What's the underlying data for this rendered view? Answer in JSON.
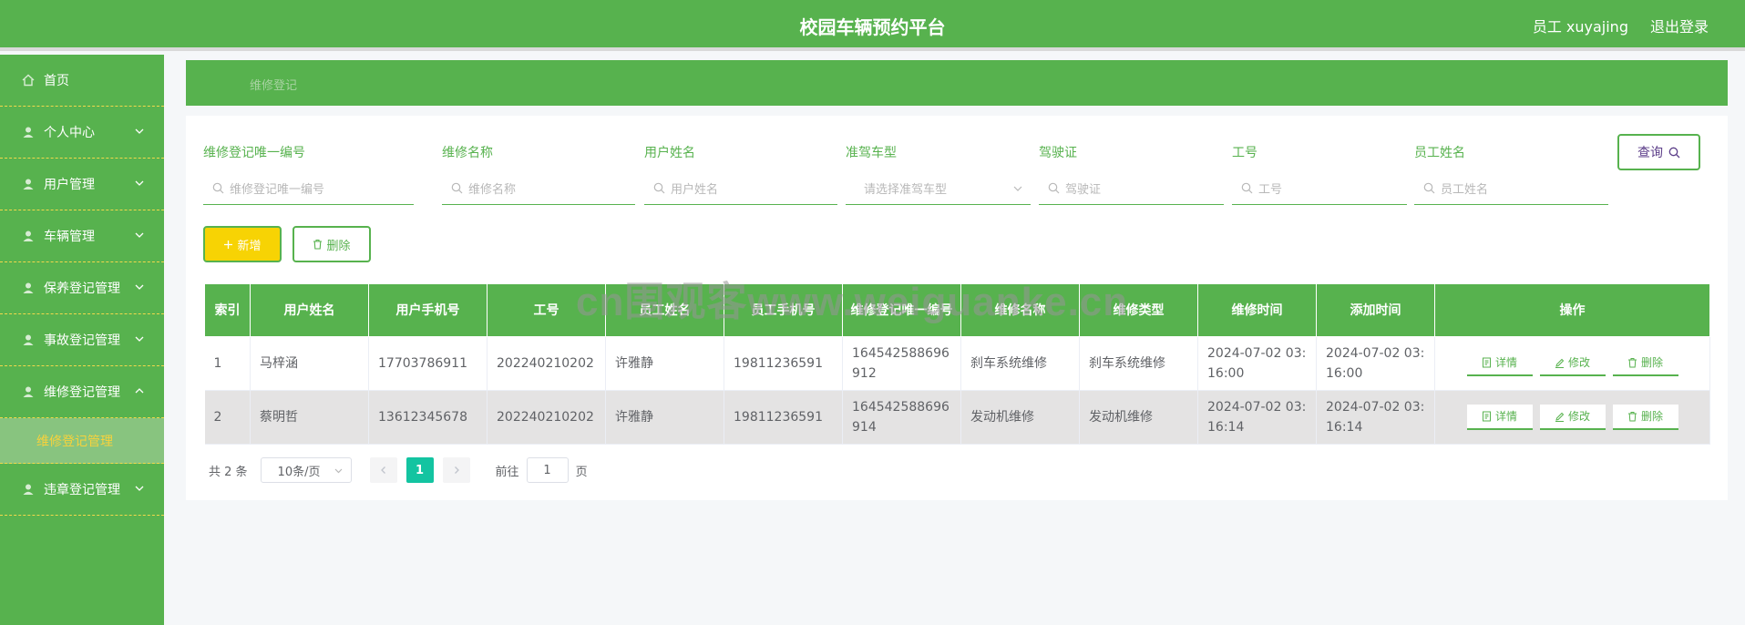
{
  "header": {
    "title": "校园车辆预约平台",
    "user_label": "员工 xuyajing",
    "logout_label": "退出登录"
  },
  "sidebar": {
    "items": [
      {
        "label": "首页",
        "icon": "home-icon"
      },
      {
        "label": "个人中心",
        "icon": "user-icon"
      },
      {
        "label": "用户管理",
        "icon": "user-icon"
      },
      {
        "label": "车辆管理",
        "icon": "user-icon"
      },
      {
        "label": "保养登记管理",
        "icon": "user-icon"
      },
      {
        "label": "事故登记管理",
        "icon": "user-icon"
      },
      {
        "label": "维修登记管理",
        "icon": "user-icon"
      },
      {
        "label": "违章登记管理",
        "icon": "user-icon"
      }
    ],
    "active_subitem": "维修登记管理"
  },
  "breadcrumb": "维修登记",
  "filters": [
    {
      "label": "维修登记唯一编号",
      "placeholder": "维修登记唯一编号"
    },
    {
      "label": "维修名称",
      "placeholder": "维修名称"
    },
    {
      "label": "用户姓名",
      "placeholder": "用户姓名"
    },
    {
      "label": "准驾车型",
      "placeholder": "请选择准驾车型"
    },
    {
      "label": "驾驶证",
      "placeholder": "驾驶证"
    },
    {
      "label": "工号",
      "placeholder": "工号"
    },
    {
      "label": "员工姓名",
      "placeholder": "员工姓名"
    }
  ],
  "buttons": {
    "query": "查询",
    "add": "新增",
    "delete": "删除"
  },
  "table": {
    "columns": [
      "索引",
      "用户姓名",
      "用户手机号",
      "工号",
      "员工姓名",
      "员工手机号",
      "维修登记唯一编号",
      "维修名称",
      "维修类型",
      "维修时间",
      "添加时间",
      "操作"
    ],
    "rows": [
      [
        "1",
        "马梓涵",
        "17703786911",
        "202240210202",
        "许雅静",
        "19811236591",
        "164542588696912",
        "刹车系统维修",
        "刹车系统维修",
        "2024-07-02 03:16:00",
        "2024-07-02 03:16:00"
      ],
      [
        "2",
        "蔡明哲",
        "13612345678",
        "202240210202",
        "许雅静",
        "19811236591",
        "164542588696914",
        "发动机维修",
        "发动机维修",
        "2024-07-02 03:16:14",
        "2024-07-02 03:16:14"
      ]
    ],
    "actions": {
      "detail": "详情",
      "edit": "修改",
      "delete": "删除"
    }
  },
  "pagination": {
    "total": "共 2 条",
    "page_size": "10条/页",
    "current_page": "1",
    "goto_prefix": "前往",
    "goto_value": "1",
    "goto_suffix": "页"
  },
  "watermark": "cn围观客www.weiguanke.cn"
}
